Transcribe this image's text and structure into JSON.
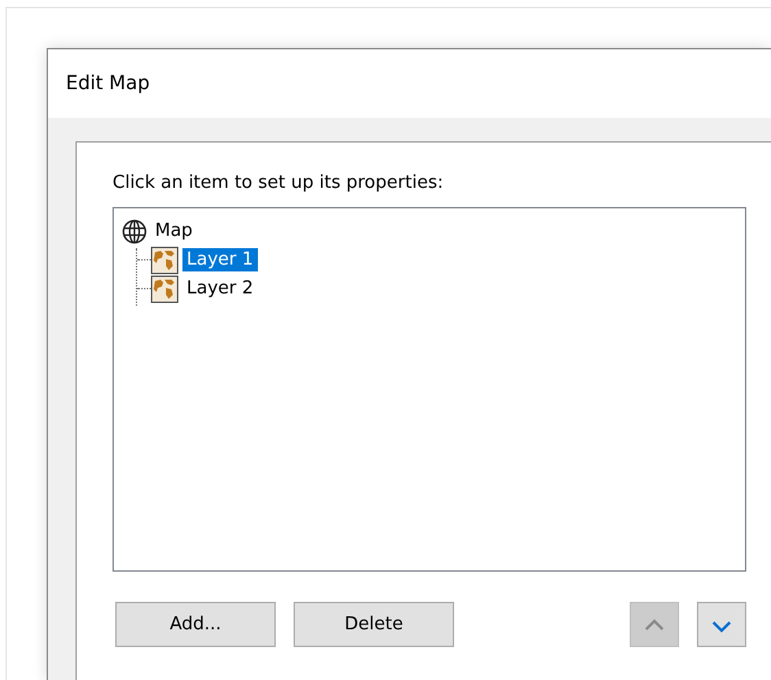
{
  "window": {
    "title": "Edit Map"
  },
  "instruction": "Click an item to set up its properties:",
  "tree": [
    {
      "label": "Map",
      "kind": "map",
      "selected": false,
      "children": [
        {
          "label": "Layer 1",
          "kind": "layer",
          "selected": true
        },
        {
          "label": "Layer 2",
          "kind": "layer",
          "selected": false
        }
      ]
    }
  ],
  "buttons": [
    {
      "label": "Add..."
    },
    {
      "label": "Delete"
    }
  ],
  "move_buttons": [
    {
      "kind": "up",
      "disabled": true
    },
    {
      "kind": "down",
      "disabled": false
    }
  ]
}
